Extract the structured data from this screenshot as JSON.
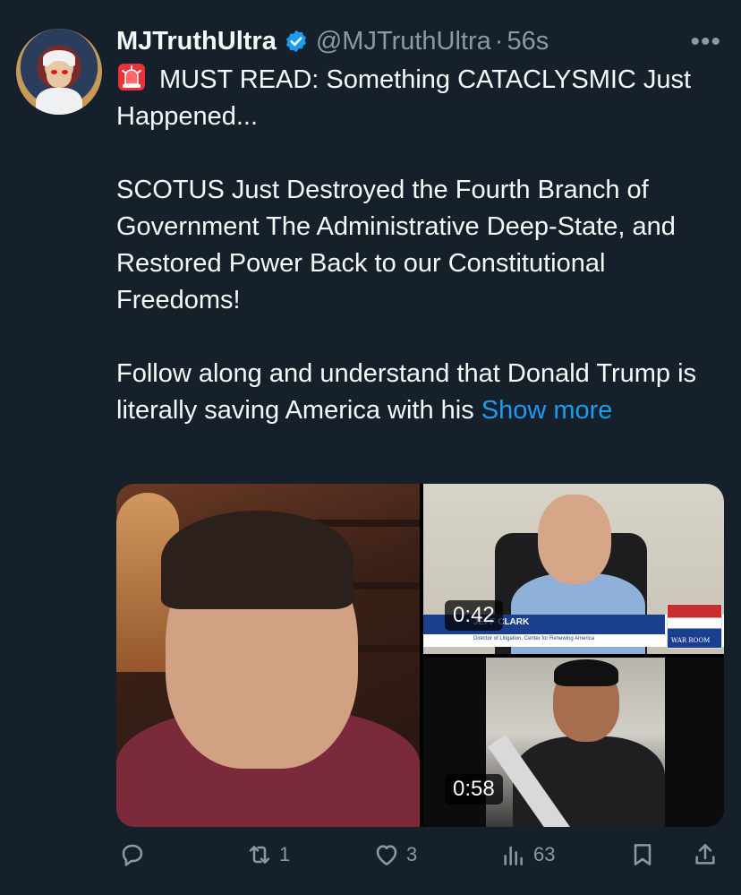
{
  "author": {
    "name": "MJTruthUltra",
    "handle": "@MJTruthUltra",
    "separator": "·",
    "time": "56s"
  },
  "more_icon": "more-horizontal-icon",
  "tweet": {
    "line1": "MUST READ: Something CATACLYSMIC Just Happened...",
    "para2": "SCOTUS Just Destroyed the Fourth Branch of Government The Administrative Deep-State, and Restored Power Back to our Constitutional Freedoms!",
    "para3": "Follow along and understand that Donald Trump is literally saving America with his",
    "show_more": "Show more"
  },
  "media": [
    {
      "name": "video-1"
    },
    {
      "name": "video-2",
      "duration": "0:42",
      "lower_third_name": "JEFF CLARK",
      "lower_third_title": "Director of Litigation, Center for Renewing America",
      "logo_text": "WAR ROOM"
    },
    {
      "name": "video-3",
      "duration": "0:58"
    }
  ],
  "actions": {
    "reply": {
      "icon": "reply-icon",
      "count": ""
    },
    "repost": {
      "icon": "repost-icon",
      "count": "1"
    },
    "like": {
      "icon": "heart-icon",
      "count": "3"
    },
    "views": {
      "icon": "views-icon",
      "count": "63"
    },
    "bookmark": {
      "icon": "bookmark-icon"
    },
    "share": {
      "icon": "share-icon"
    }
  },
  "colors": {
    "background": "#15202b",
    "text": "#f7f9f9",
    "secondary": "#8b98a5",
    "accent": "#1d9bf0"
  }
}
